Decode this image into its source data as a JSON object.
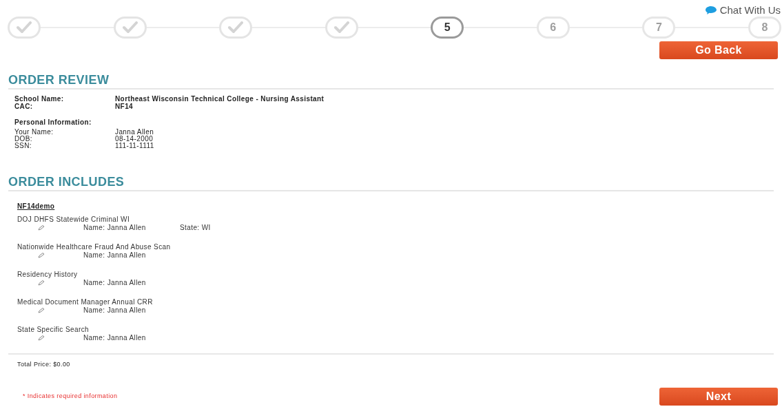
{
  "chat_link": "Chat With Us",
  "steps": [
    {
      "completed": true,
      "selected": false
    },
    {
      "completed": true,
      "selected": false
    },
    {
      "completed": true,
      "selected": false
    },
    {
      "completed": true,
      "selected": false
    },
    {
      "label": "5",
      "completed": false,
      "selected": true
    },
    {
      "label": "6",
      "completed": false,
      "selected": false
    },
    {
      "label": "7",
      "completed": false,
      "selected": false
    },
    {
      "label": "8",
      "completed": false,
      "selected": false
    }
  ],
  "go_back_button": "Go Back",
  "order_review": {
    "heading": "ORDER REVIEW",
    "school_rows": [
      {
        "label": "School Name:",
        "value": "Northeast Wisconsin Technical College - Nursing Assistant"
      },
      {
        "label": "CAC:",
        "value": "NF14"
      }
    ],
    "personal_heading": "Personal Information:",
    "personal_rows": [
      {
        "label": "Your Name:",
        "value": "Janna Allen"
      },
      {
        "label": "DOB:",
        "value": "08-14-2000"
      },
      {
        "label": "SSN:",
        "value": "111-11-1111"
      }
    ]
  },
  "order_includes": {
    "heading": "ORDER INCLUDES",
    "package": "NF14demo",
    "items": [
      {
        "name": "DOJ DHFS Statewide Criminal WI",
        "fields": [
          "Name: Janna Allen",
          "State: WI"
        ]
      },
      {
        "name": "Nationwide Healthcare Fraud And Abuse Scan",
        "fields": [
          "Name: Janna Allen"
        ]
      },
      {
        "name": "Residency History",
        "fields": [
          "Name: Janna Allen"
        ]
      },
      {
        "name": "Medical Document Manager Annual CRR",
        "fields": [
          "Name: Janna Allen"
        ]
      },
      {
        "name": "State Specific Search",
        "fields": [
          "Name: Janna Allen"
        ]
      }
    ]
  },
  "total_price": "Total Price: $0.00",
  "required_note": "* Indicates required information",
  "next_button": "Next"
}
